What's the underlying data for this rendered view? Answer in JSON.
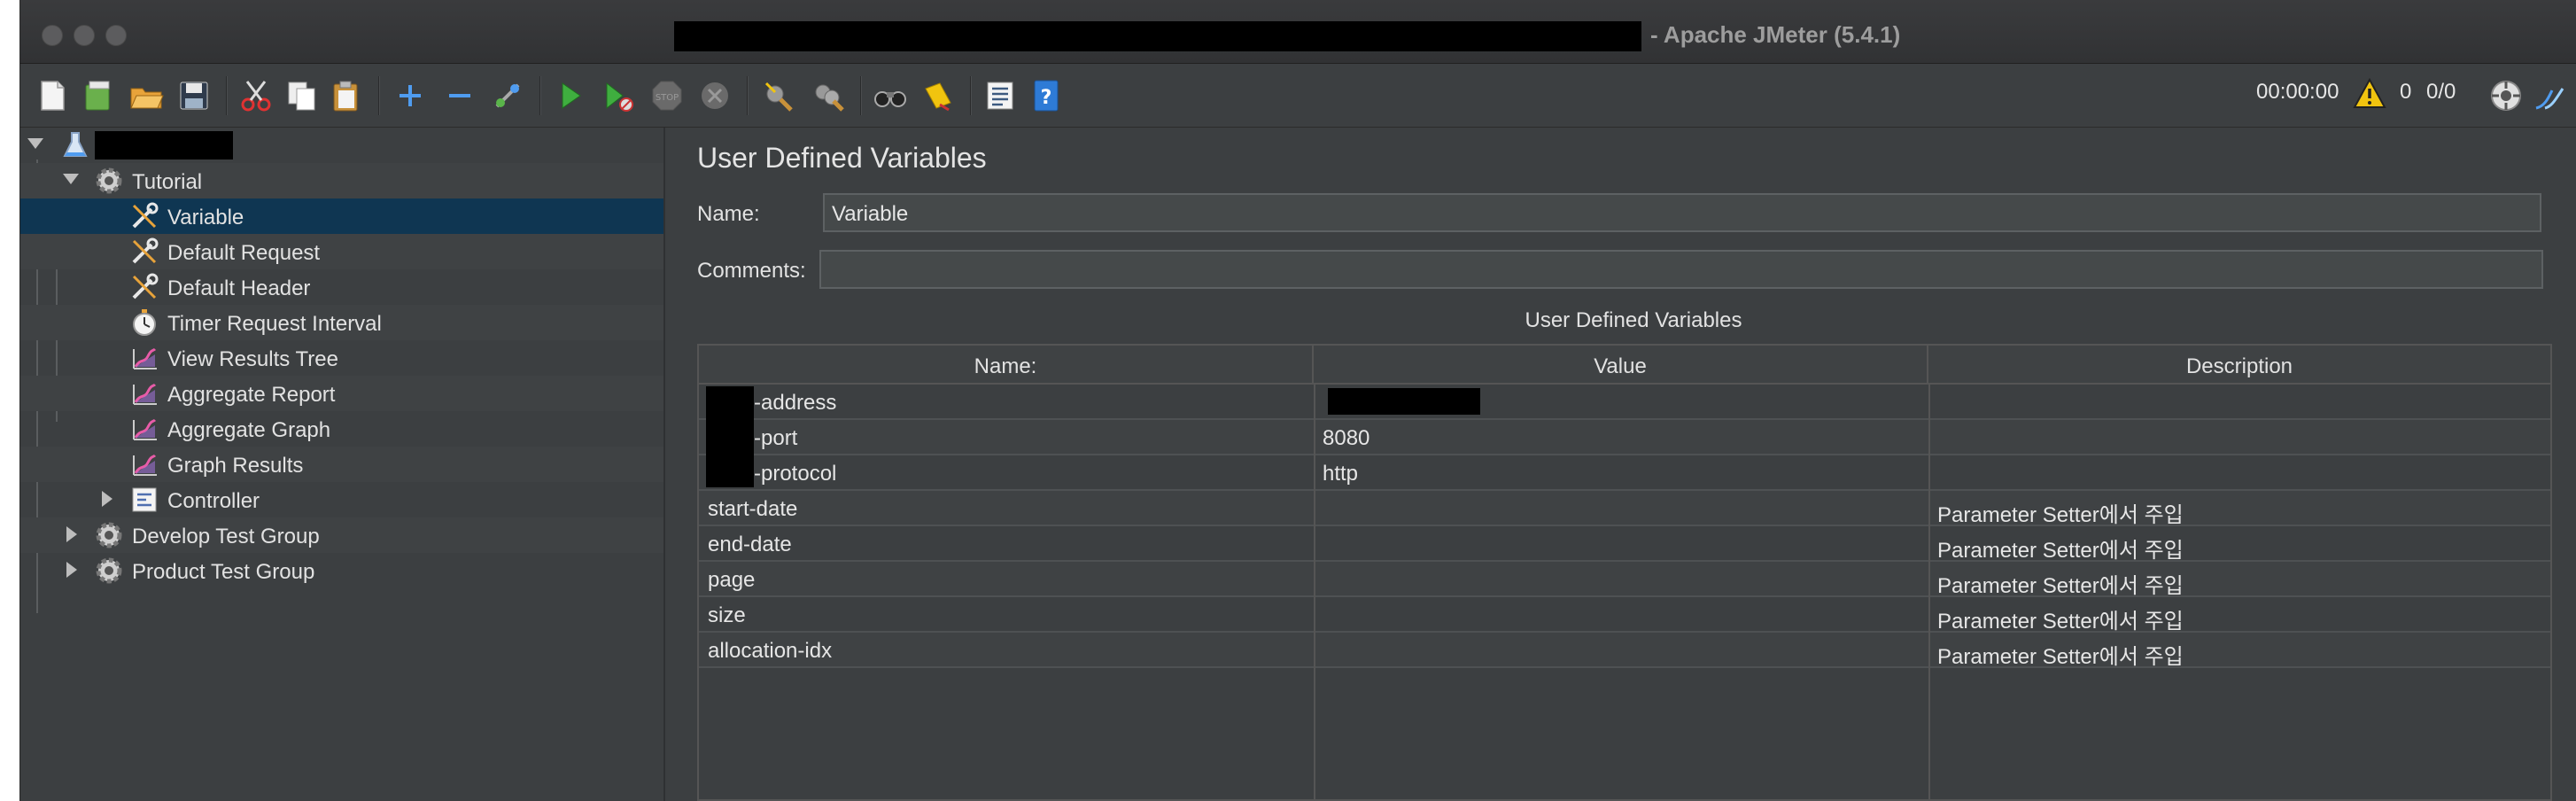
{
  "window": {
    "title": "- Apache JMeter (5.4.1)"
  },
  "toolbar": {
    "items": [
      {
        "name": "new-icon"
      },
      {
        "name": "templates-icon"
      },
      {
        "name": "open-icon"
      },
      {
        "name": "save-icon"
      },
      {
        "name": "cut-icon"
      },
      {
        "name": "copy-icon"
      },
      {
        "name": "paste-icon"
      },
      {
        "name": "expand-icon"
      },
      {
        "name": "collapse-icon"
      },
      {
        "name": "toggle-icon"
      },
      {
        "name": "start-icon"
      },
      {
        "name": "start-no-timers-icon"
      },
      {
        "name": "stop-icon"
      },
      {
        "name": "shutdown-icon"
      },
      {
        "name": "clear-icon"
      },
      {
        "name": "clear-all-icon"
      },
      {
        "name": "search-icon"
      },
      {
        "name": "reset-search-icon"
      },
      {
        "name": "function-helper-icon"
      },
      {
        "name": "help-icon"
      }
    ],
    "timer": "00:00:00",
    "warning_count": "0",
    "thread_count": "0/0"
  },
  "tree": {
    "items": [
      {
        "label": "",
        "level": 0,
        "expanded": true,
        "icon": "flask-icon"
      },
      {
        "label": "Tutorial",
        "level": 1,
        "expanded": true,
        "icon": "gear-icon"
      },
      {
        "label": "Variable",
        "level": 2,
        "icon": "wrench-icon",
        "selected": true
      },
      {
        "label": "Default Request",
        "level": 2,
        "icon": "wrench-icon"
      },
      {
        "label": "Default Header",
        "level": 2,
        "icon": "wrench-icon"
      },
      {
        "label": "Timer Request Interval",
        "level": 2,
        "icon": "timer-icon"
      },
      {
        "label": "View Results Tree",
        "level": 2,
        "icon": "graph-icon"
      },
      {
        "label": "Aggregate Report",
        "level": 2,
        "icon": "graph-icon"
      },
      {
        "label": "Aggregate Graph",
        "level": 2,
        "icon": "graph-icon"
      },
      {
        "label": "Graph Results",
        "level": 2,
        "icon": "graph-icon"
      },
      {
        "label": "Controller",
        "level": 2,
        "expanded": false,
        "icon": "controller-icon"
      },
      {
        "label": "Develop Test Group",
        "level": 1,
        "expanded": false,
        "icon": "gear-icon"
      },
      {
        "label": "Product Test Group",
        "level": 1,
        "expanded": false,
        "icon": "gear-icon"
      }
    ]
  },
  "main": {
    "title": "User Defined Variables",
    "name_label": "Name:",
    "name_value": "Variable",
    "comments_label": "Comments:",
    "comments_value": "",
    "table_title": "User Defined Variables",
    "columns": [
      "Name:",
      "Value",
      "Description"
    ],
    "rows": [
      {
        "name": "-address",
        "value": "",
        "description": ""
      },
      {
        "name": "-port",
        "value": "8080",
        "description": ""
      },
      {
        "name": "-protocol",
        "value": "http",
        "description": ""
      },
      {
        "name": "start-date",
        "value": "",
        "description": "Parameter Setter에서 주입"
      },
      {
        "name": "end-date",
        "value": "",
        "description": "Parameter Setter에서 주입"
      },
      {
        "name": "page",
        "value": "",
        "description": "Parameter Setter에서 주입"
      },
      {
        "name": "size",
        "value": "",
        "description": "Parameter Setter에서 주입"
      },
      {
        "name": "allocation-idx",
        "value": "",
        "description": "Parameter Setter에서 주입"
      }
    ]
  },
  "colors": {
    "background": "#3c3f41",
    "selection": "#0f3652",
    "text": "#e2e2e2"
  }
}
